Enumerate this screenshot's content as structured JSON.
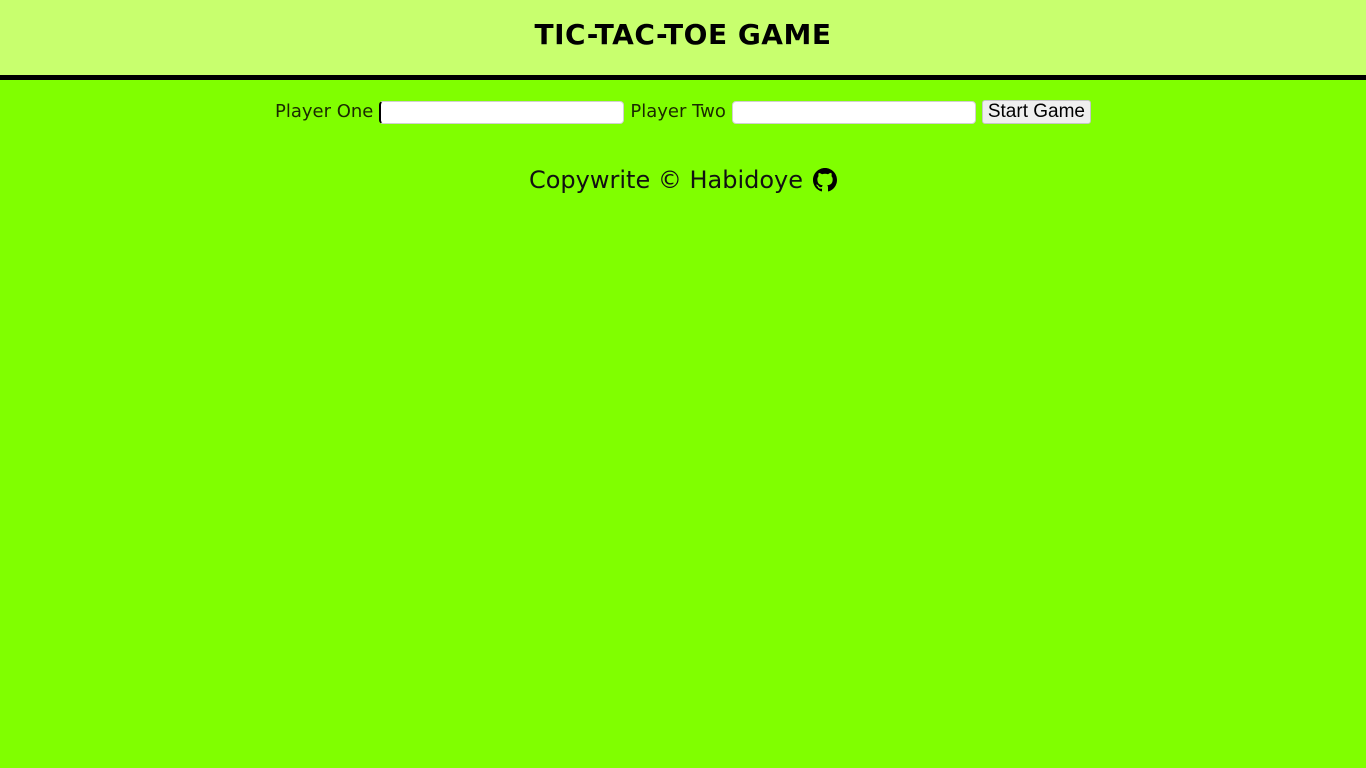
{
  "header": {
    "title": "TIC-TAC-TOE GAME"
  },
  "form": {
    "player_one_label": "Player One",
    "player_one_value": "",
    "player_two_label": "Player Two",
    "player_two_value": "",
    "start_button_label": "Start Game"
  },
  "footer": {
    "text": "Copywrite © Habidoye",
    "icon": "github-icon"
  },
  "colors": {
    "page_background": "#80ff00",
    "header_background": "#c8ff6e",
    "header_border": "#000000"
  }
}
